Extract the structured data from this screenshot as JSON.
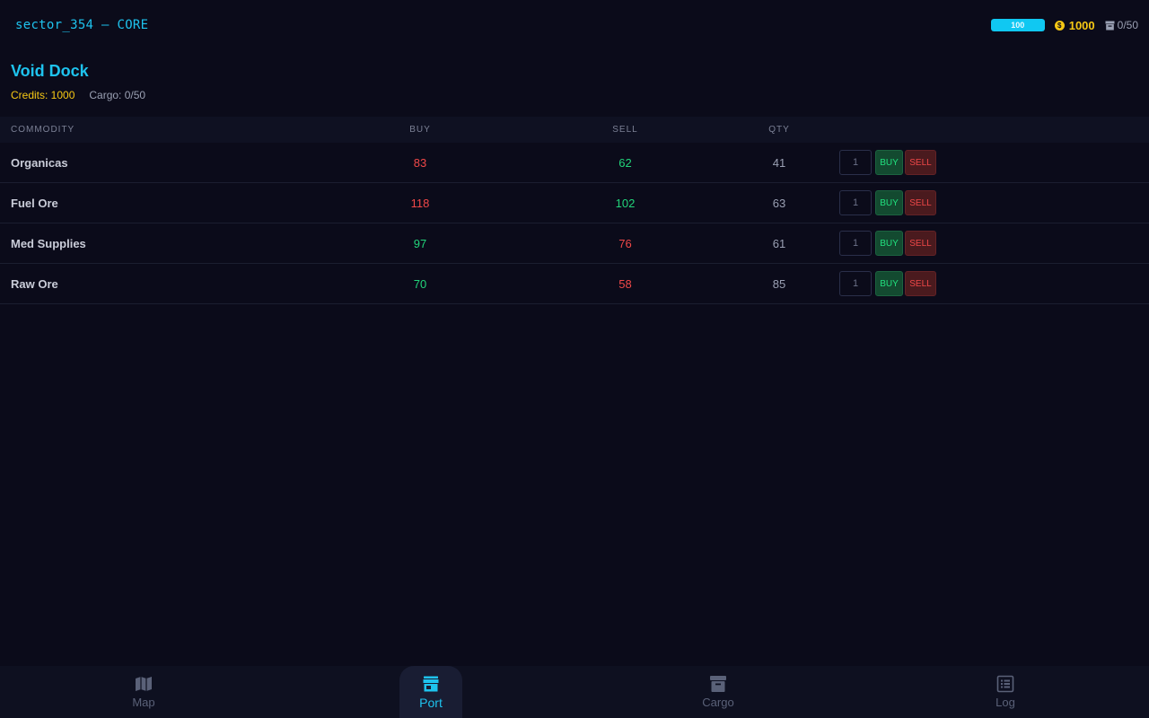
{
  "header": {
    "sector": "sector_354 — CORE",
    "hull": {
      "value": 100,
      "label": "100",
      "percent": 100
    },
    "credits": "1000",
    "coin_glyph": "$",
    "cargo": "0/50"
  },
  "station": {
    "name": "Void Dock",
    "credits_label": "Credits: 1000",
    "cargo_label": "Cargo: 0/50"
  },
  "market": {
    "columns": [
      "COMMODITY",
      "BUY",
      "SELL",
      "QTY"
    ],
    "rows": [
      {
        "name": "Organicas",
        "buy": "83",
        "buy_status": "bad",
        "sell": "62",
        "sell_status": "good",
        "qty": "41",
        "input": "1",
        "buy_label": "BUY",
        "sell_label": "SELL"
      },
      {
        "name": "Fuel Ore",
        "buy": "118",
        "buy_status": "bad",
        "sell": "102",
        "sell_status": "good",
        "qty": "63",
        "input": "1",
        "buy_label": "BUY",
        "sell_label": "SELL"
      },
      {
        "name": "Med Supplies",
        "buy": "97",
        "buy_status": "good",
        "sell": "76",
        "sell_status": "bad",
        "qty": "61",
        "input": "1",
        "buy_label": "BUY",
        "sell_label": "SELL"
      },
      {
        "name": "Raw Ore",
        "buy": "70",
        "buy_status": "good",
        "sell": "58",
        "sell_status": "bad",
        "qty": "85",
        "input": "1",
        "buy_label": "BUY",
        "sell_label": "SELL"
      }
    ]
  },
  "nav": [
    {
      "label": "Map",
      "icon": "map-icon",
      "active": false
    },
    {
      "label": "Port",
      "icon": "store-icon",
      "active": true
    },
    {
      "label": "Cargo",
      "icon": "archive-icon",
      "active": false
    },
    {
      "label": "Log",
      "icon": "list-icon",
      "active": false
    }
  ],
  "colors": {
    "accent": "#1ec3ee",
    "credits": "#f6c814",
    "good": "#22d47a",
    "bad": "#f04848",
    "background": "#0b0b1a"
  }
}
